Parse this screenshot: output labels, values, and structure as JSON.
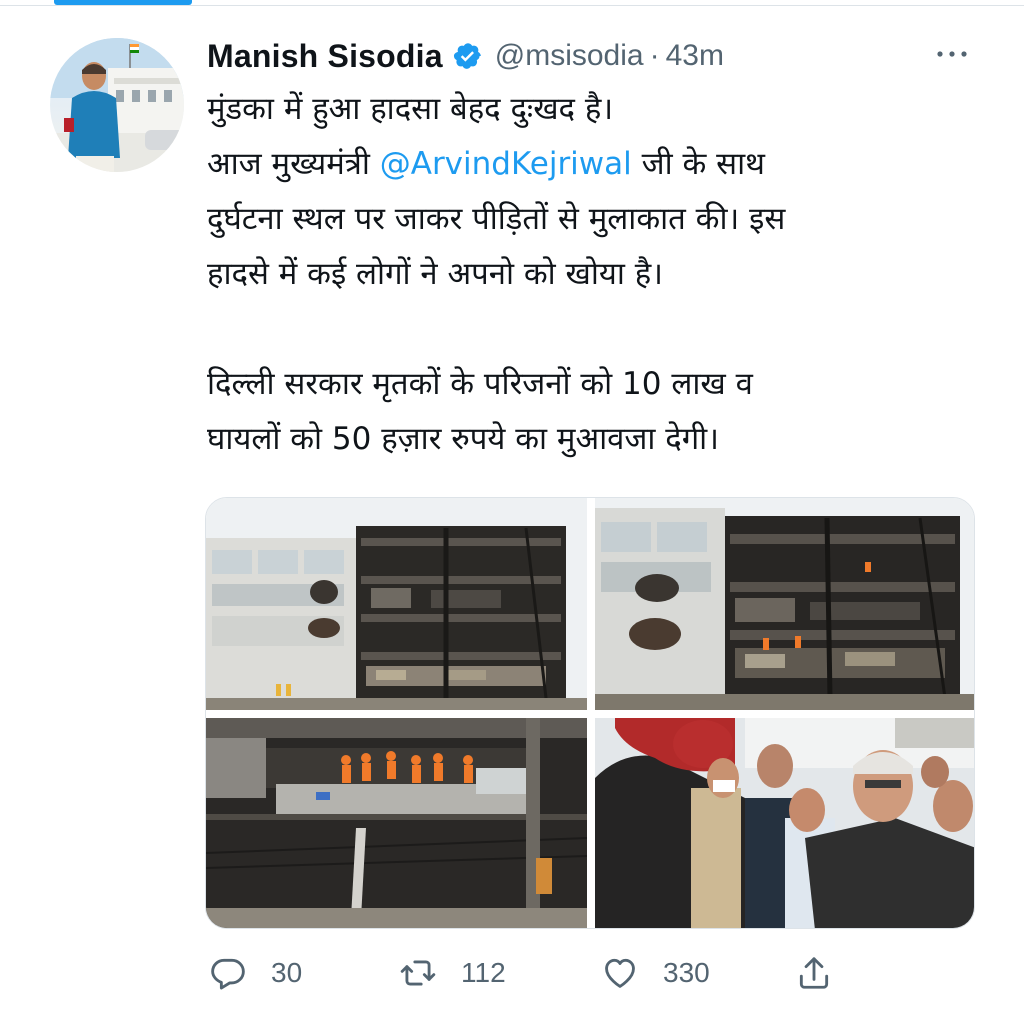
{
  "tweet": {
    "author_name": "Manish Sisodia",
    "verified": true,
    "handle": "@msisodia",
    "separator": "·",
    "timestamp": "43m",
    "lines": [
      {
        "text": "मुंडका में हुआ हादसा बेहद दुःखद है।"
      },
      {
        "before": "आज मुख्यमंत्री ",
        "mention": "@ArvindKejriwal",
        "after": " जी के साथ"
      },
      {
        "text": "दुर्घटना स्थल पर जाकर पीड़ितों से मुलाकात की। इस"
      },
      {
        "text": "हादसे में  कई लोगों ने अपनो को खोया है।"
      },
      {
        "text": ""
      },
      {
        "text": "दिल्ली सरकार मृतकों के परिजनों को 10 लाख व"
      },
      {
        "text": "घायलों को 50 हज़ार रुपये का मुआवजा देगी।"
      }
    ]
  },
  "media": {
    "photo_count": 4
  },
  "actions": {
    "replies": "30",
    "retweets": "112",
    "likes": "330"
  },
  "icons": {
    "verified": "verified-badge-icon",
    "more": "more-options-icon",
    "reply": "reply-icon",
    "retweet": "retweet-icon",
    "like": "heart-icon",
    "share": "share-icon"
  },
  "colors": {
    "accent": "#1d9bf0",
    "text_primary": "#0f1419",
    "text_secondary": "#536471",
    "divider": "#dde3e8"
  }
}
